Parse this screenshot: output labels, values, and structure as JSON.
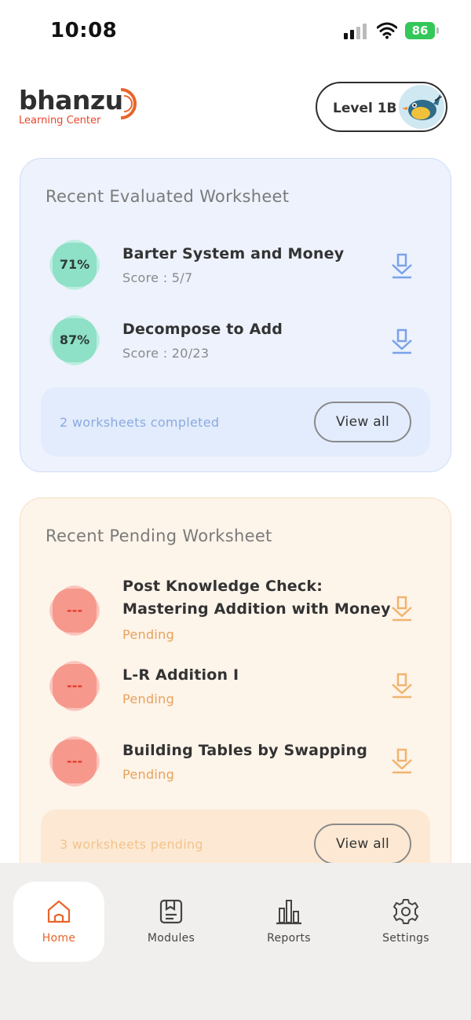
{
  "status_bar": {
    "time": "10:08",
    "battery": "86"
  },
  "header": {
    "logo_word": "bhanzu",
    "logo_sub": "Learning Center",
    "level": "Level 1B"
  },
  "evaluated": {
    "title": "Recent Evaluated Worksheet",
    "items": [
      {
        "badge": "71%",
        "name": "Barter System and Money",
        "sub": "Score : 5/7"
      },
      {
        "badge": "87%",
        "name": "Decompose to Add",
        "sub": "Score : 20/23"
      }
    ],
    "footer_text": "2 worksheets completed",
    "view_all": "View all"
  },
  "pending": {
    "title": "Recent Pending Worksheet",
    "items": [
      {
        "badge": "---",
        "name_line1": "Post Knowledge Check:",
        "name_line2": "Mastering Addition with Money",
        "sub": "Pending"
      },
      {
        "badge": "---",
        "name": "L-R Addition I",
        "sub": "Pending"
      },
      {
        "badge": "---",
        "name": "Building Tables by Swapping",
        "sub": "Pending"
      }
    ],
    "footer_text": "3 worksheets pending",
    "view_all": "View all"
  },
  "nav": {
    "items": [
      {
        "label": "Home",
        "icon": "home-icon",
        "active": true
      },
      {
        "label": "Modules",
        "icon": "modules-icon"
      },
      {
        "label": "Reports",
        "icon": "reports-icon"
      },
      {
        "label": "Settings",
        "icon": "settings-icon"
      }
    ]
  },
  "colors": {
    "accent": "#e8652a",
    "evaluated_bg": "#edf2fd",
    "pending_bg": "#fdf4ea",
    "badge_green": "#8ee0c6",
    "badge_red": "#f7988c",
    "download_blue": "#7aa2e8",
    "download_orange": "#f0b46e"
  }
}
